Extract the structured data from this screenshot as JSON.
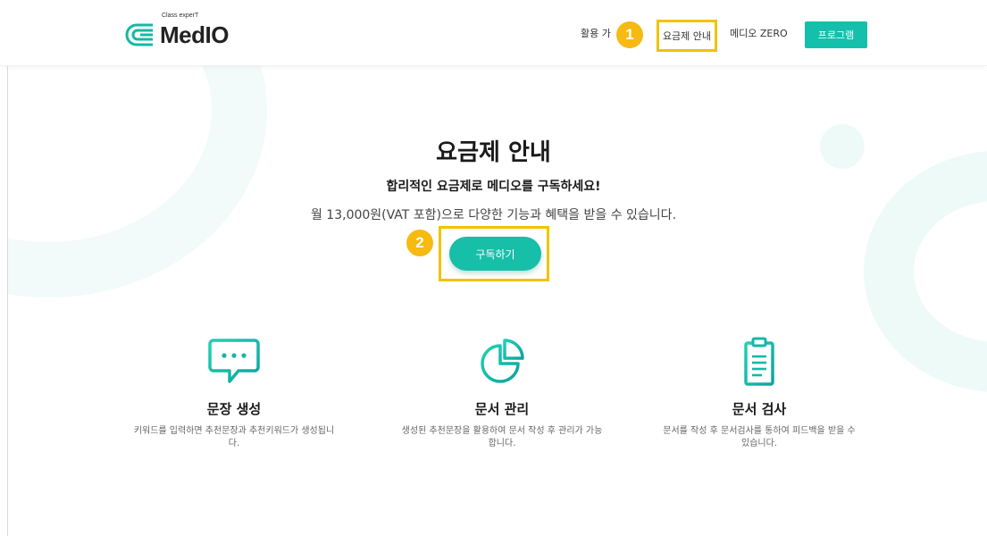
{
  "header": {
    "logo": {
      "tagline": "Class experT",
      "name": "MedIO"
    },
    "nav": {
      "usage_label": "활용 가이드",
      "pricing_label": "요금제 안내",
      "zero_label": "메디오 ZERO",
      "program_label": "프로그램"
    }
  },
  "annotations": {
    "badge_1": "1",
    "badge_2": "2"
  },
  "hero": {
    "title": "요금제 안내",
    "subtitle": "합리적인 요금제로 메디오를 구독하세요!",
    "description": "월 13,000원(VAT 포함)으로 다양한 기능과 혜택을 받을 수 있습니다.",
    "subscribe_label": "구독하기"
  },
  "features": [
    {
      "icon": "chat-icon",
      "title": "문장 생성",
      "description": "키워드를 입력하면 추천문장과 추천키워드가 생성됩니다."
    },
    {
      "icon": "pie-chart-icon",
      "title": "문서 관리",
      "description": "생성된 추천문장을 활용하여 문서 작성 후 관리가 가능합니다."
    },
    {
      "icon": "clipboard-icon",
      "title": "문서 검사",
      "description": "문서를 작성 후 문서검사를 통하여 피드백을 받을 수 있습니다."
    }
  ],
  "colors": {
    "accent": "#14c0ac",
    "highlight": "#f2c200",
    "badge": "#f6ba12"
  }
}
